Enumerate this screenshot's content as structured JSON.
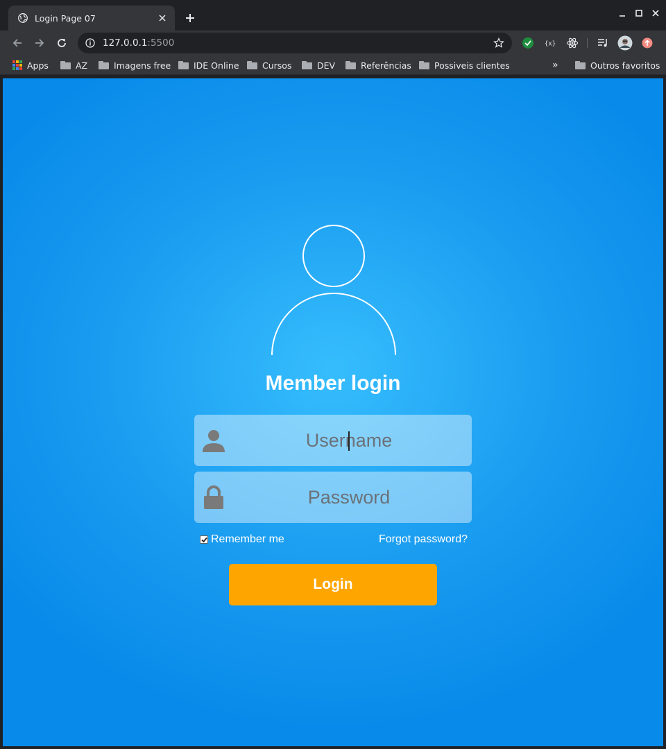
{
  "browser": {
    "tab": {
      "title": "Login Page 07"
    },
    "address": {
      "host": "127.0.0.1",
      "port": ":5500"
    },
    "bookmarks": [
      {
        "label": "Apps"
      },
      {
        "label": "AZ"
      },
      {
        "label": "Imagens free"
      },
      {
        "label": "IDE Online"
      },
      {
        "label": "Cursos"
      },
      {
        "label": "DEV"
      },
      {
        "label": "Referências"
      },
      {
        "label": "Possiveis clientes"
      }
    ],
    "overflow_label": "»",
    "other_bookmarks": "Outros favoritos"
  },
  "login": {
    "title": "Member login",
    "username": {
      "placeholder": "Username",
      "value": ""
    },
    "password": {
      "placeholder": "Password",
      "value": ""
    },
    "remember_label": "Remember me",
    "remember_checked": true,
    "forgot_label": "Forgot password?",
    "submit_label": "Login"
  },
  "colors": {
    "page_center": "#36bdfd",
    "page_edge": "#088aea",
    "button": "#ffa500",
    "field_icon": "#7a7a7a"
  },
  "icons": [
    "globe-icon",
    "close-icon",
    "plus-icon",
    "minimize-icon",
    "maximize-icon",
    "back-icon",
    "forward-icon",
    "reload-icon",
    "info-icon",
    "star-icon",
    "user-icon",
    "lock-icon",
    "folder-icon",
    "apps-grid-icon"
  ]
}
